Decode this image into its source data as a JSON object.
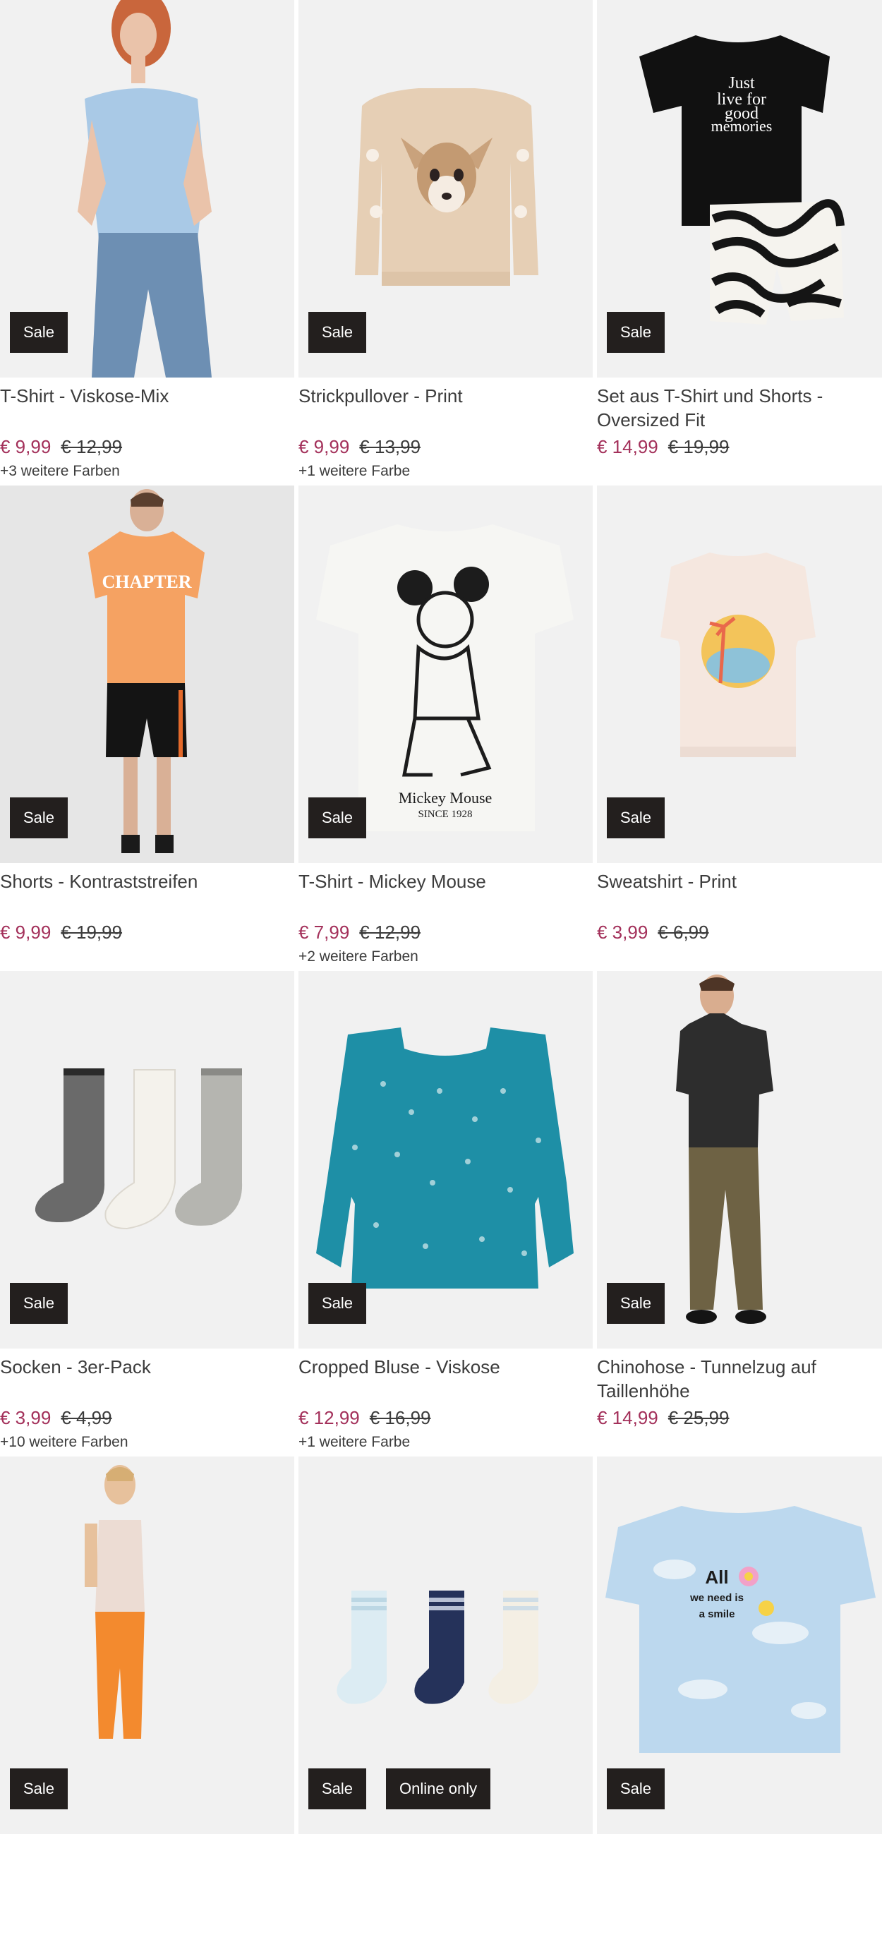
{
  "products": [
    {
      "title": "T-Shirt - Viskose-Mix",
      "price_new": "€ 9,99",
      "price_old": "€ 12,99",
      "colors": "+3 weitere Farben",
      "badges": [
        "Sale"
      ],
      "image": "model-woman-light-blue-tshirt-jeans"
    },
    {
      "title": "Strickpullover - Print",
      "price_new": "€ 9,99",
      "price_old": "€ 13,99",
      "colors": "+1 weitere Farbe",
      "badges": [
        "Sale"
      ],
      "image": "beige-knit-sweater-deer-face"
    },
    {
      "title": "Set aus T-Shirt und Shorts - Oversized Fit",
      "price_new": "€ 14,99",
      "price_old": "€ 19,99",
      "colors": "",
      "badges": [
        "Sale"
      ],
      "image": "black-tshirt-zebra-shorts-set"
    },
    {
      "title": "Shorts - Kontraststreifen",
      "price_new": "€ 9,99",
      "price_old": "€ 19,99",
      "colors": "",
      "badges": [
        "Sale"
      ],
      "image": "model-man-orange-tshirt-black-shorts"
    },
    {
      "title": "T-Shirt - Mickey Mouse",
      "price_new": "€ 7,99",
      "price_old": "€ 12,99",
      "colors": "+2 weitere Farben",
      "badges": [
        "Sale"
      ],
      "image": "white-tshirt-mickey-mouse-print"
    },
    {
      "title": "Sweatshirt - Print",
      "price_new": "€ 3,99",
      "price_old": "€ 6,99",
      "colors": "",
      "badges": [
        "Sale"
      ],
      "image": "kids-sweatshirt-palm-print"
    },
    {
      "title": "Socken - 3er-Pack",
      "price_new": "€ 3,99",
      "price_old": "€ 4,99",
      "colors": "+10 weitere Farben",
      "badges": [
        "Sale"
      ],
      "image": "three-socks-herringbone"
    },
    {
      "title": "Cropped Bluse - Viskose",
      "price_new": "€ 12,99",
      "price_old": "€ 16,99",
      "colors": "+1 weitere Farbe",
      "badges": [
        "Sale"
      ],
      "image": "teal-floral-cropped-blouse"
    },
    {
      "title": "Chinohose - Tunnelzug auf Taillenhöhe",
      "price_new": "€ 14,99",
      "price_old": "€ 25,99",
      "colors": "",
      "badges": [
        "Sale"
      ],
      "image": "model-man-olive-chinos-hoodie"
    },
    {
      "title": "",
      "price_new": "",
      "price_old": "",
      "colors": "",
      "badges": [
        "Sale"
      ],
      "image": "model-woman-orange-leggings-tank"
    },
    {
      "title": "",
      "price_new": "",
      "price_old": "",
      "colors": "",
      "badges": [
        "Sale",
        "Online only"
      ],
      "image": "three-kids-socks"
    },
    {
      "title": "",
      "price_new": "",
      "price_old": "",
      "colors": "",
      "badges": [
        "Sale"
      ],
      "image": "tie-dye-tshirt-smile-print"
    }
  ],
  "labels": {
    "p0": {
      "word": "Sale"
    },
    "shirt3_lines": [
      "Just",
      "live for",
      "good",
      "memories"
    ],
    "mickey_lines": [
      "Mickey Mouse",
      "SINCE 1928"
    ],
    "chapter": "CHAPTER",
    "tiedye_lines": [
      "All",
      "we need is",
      "a smile"
    ]
  },
  "colors": {
    "sale_price": "#a3305a",
    "badge_bg": "#231f1e",
    "image_bg": "#f1f1f1",
    "text": "#3c3c3c"
  }
}
